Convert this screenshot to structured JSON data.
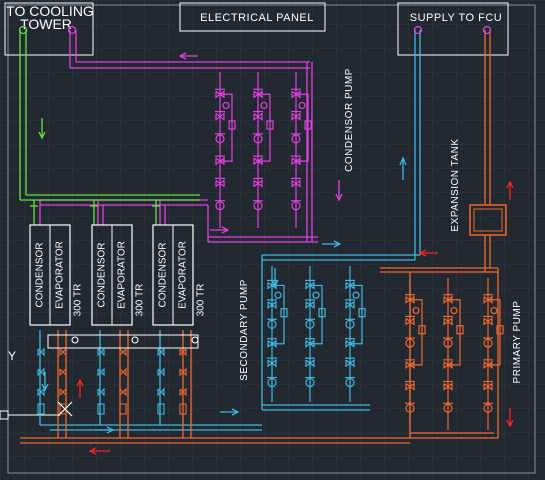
{
  "labels": {
    "cooling_tower": [
      "TO COOLING",
      "TOWER"
    ],
    "electrical_panel": "ELECTRICAL PANEL",
    "supply_to_fcu": "SUPPLY TO FCU",
    "condensor_pump": "CONDENSOR PUMP",
    "expansion_tank": "EXPANSION TANK",
    "secondary_pump": "SECONDARY PUMP",
    "primary_pump": "PRIMARY PUMP",
    "axis_y": "Y"
  },
  "chillers": [
    {
      "condensor": "CONDENSOR",
      "evaporator": "EVAPORATOR",
      "capacity": "300 TR"
    },
    {
      "condensor": "CONDENSOR",
      "evaporator": "EVAPORATOR",
      "capacity": "300 TR"
    },
    {
      "condensor": "CONDENSOR",
      "evaporator": "EVAPORATOR",
      "capacity": "300 TR"
    }
  ],
  "colors": {
    "background": "#212830",
    "grid": "#2c343d",
    "condenser_water": "#e040e0",
    "cooling_tower_line": "#66e040",
    "chilled_supply": "#40b8e0",
    "chilled_return": "#f06830",
    "outline": "#ffffff",
    "arrow_red": "#ff2020"
  }
}
